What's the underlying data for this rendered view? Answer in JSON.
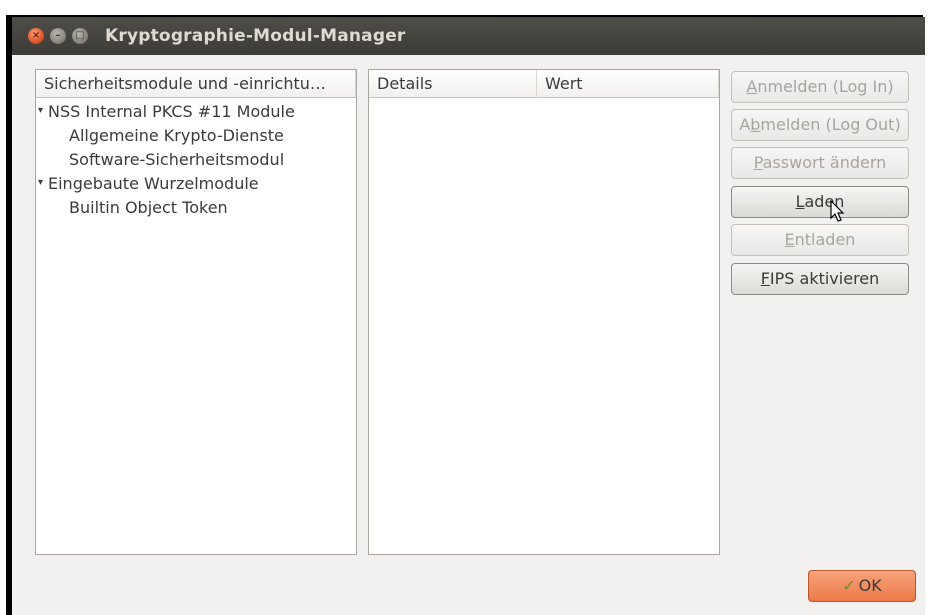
{
  "window": {
    "title": "Kryptographie-Modul-Manager"
  },
  "tree": {
    "header": "Sicherheitsmodule und -einrichtu…",
    "expander_glyph": "▾",
    "items": [
      {
        "label": "NSS Internal PKCS #11 Module",
        "level": 0,
        "expanded": true
      },
      {
        "label": "Allgemeine Krypto-Dienste",
        "level": 1
      },
      {
        "label": "Software-Sicherheitsmodul",
        "level": 1
      },
      {
        "label": "Eingebaute Wurzelmodule",
        "level": 0,
        "expanded": true
      },
      {
        "label": "Builtin Object Token",
        "level": 1
      }
    ]
  },
  "details": {
    "columns": [
      "Details",
      "Wert"
    ]
  },
  "buttons": {
    "login": {
      "mnemonic": "A",
      "label_rest": "nmelden (Log In)",
      "enabled": false
    },
    "logout": {
      "prefix": "A",
      "mnemonic": "b",
      "label_rest": "melden (Log Out)",
      "enabled": false
    },
    "password": {
      "mnemonic": "P",
      "label_rest": "asswort ändern",
      "enabled": false
    },
    "load": {
      "mnemonic": "L",
      "label_rest": "aden",
      "enabled": true
    },
    "unload": {
      "mnemonic": "E",
      "label_rest": "ntladen",
      "enabled": false
    },
    "fips": {
      "mnemonic": "F",
      "label_rest": "IPS aktivieren",
      "enabled": true
    }
  },
  "ok_button": {
    "label": "OK",
    "icon": "checkmark-icon"
  },
  "colors": {
    "titlebar": "#3c3b37",
    "close_button": "#e0542a",
    "ok_button": "#ec7a48"
  }
}
